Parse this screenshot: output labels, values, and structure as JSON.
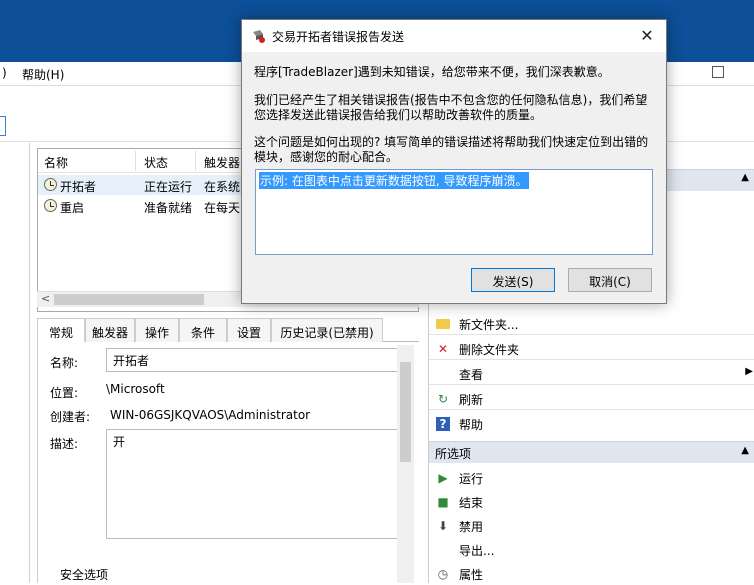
{
  "menubar": {
    "partial_left": ")",
    "help": "帮助(H)"
  },
  "task_list": {
    "columns": [
      "名称",
      "状态",
      "触发器"
    ],
    "rows": [
      {
        "name": "开拓者",
        "status": "正在运行",
        "trigger": "在系统"
      },
      {
        "name": "重启",
        "status": "准备就绪",
        "trigger": "在每天"
      }
    ]
  },
  "detail_tabs": [
    "常规",
    "触发器",
    "操作",
    "条件",
    "设置",
    "历史记录(已禁用)"
  ],
  "detail": {
    "name_label": "名称:",
    "name_value": "开拓者",
    "location_label": "位置:",
    "location_value": "\\Microsoft",
    "creator_label": "创建者:",
    "creator_value": "WIN-06GSJKQVAOS\\Administrator",
    "desc_label": "描述:",
    "desc_value": "开",
    "security_label": "安全选项"
  },
  "actions": {
    "items_top": [
      {
        "icon": "folder-new-icon",
        "label": "新文件夹..."
      },
      {
        "icon": "delete-icon",
        "label": "删除文件夹"
      },
      {
        "icon": "",
        "label": "查看"
      },
      {
        "icon": "refresh-icon",
        "label": "刷新"
      },
      {
        "icon": "help-icon",
        "label": "帮助"
      }
    ],
    "section_selected": "所选项",
    "items_selected": [
      {
        "icon": "run-icon",
        "label": "运行"
      },
      {
        "icon": "stop-icon",
        "label": "结束"
      },
      {
        "icon": "disable-icon",
        "label": "禁用"
      },
      {
        "icon": "",
        "label": "导出..."
      },
      {
        "icon": "properties-icon",
        "label": "属性"
      }
    ]
  },
  "dialog": {
    "title": "交易开拓者错误报告发送",
    "para1": "程序[TradeBlazer]遇到未知错误，给您带来不便，我们深表歉意。",
    "para2": "我们已经产生了相关错误报告(报告中不包含您的任何隐私信息)，我们希望您选择发送此错误报告给我们以帮助改善软件的质量。",
    "para3": "这个问题是如何出现的? 填写简单的错误描述将帮助我们快速定位到出错的模块，感谢您的耐心配合。",
    "placeholder": "示例: 在图表中点击更新数据按钮, 导致程序崩溃。",
    "send_button": "发送(S)",
    "cancel_button": "取消(C)"
  },
  "colors": {
    "titlebar": "#0d4f98",
    "selection": "#3399ff",
    "section_header": "#dfe6f0"
  }
}
